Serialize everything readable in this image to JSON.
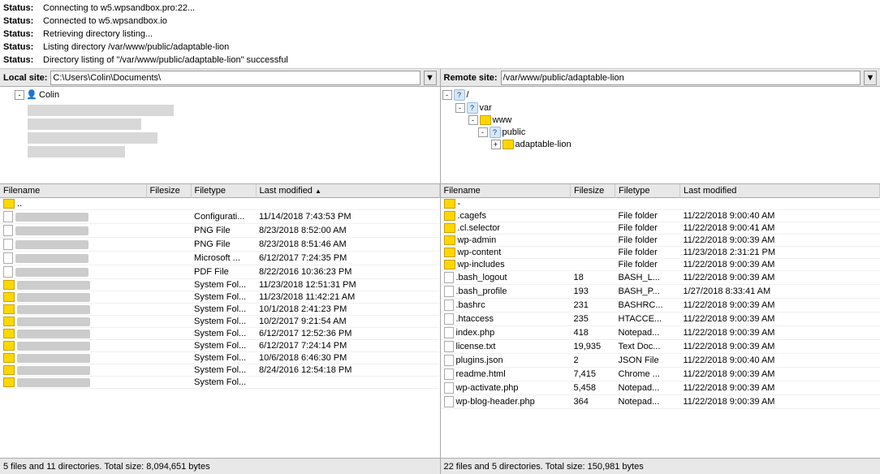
{
  "status_messages": [
    {
      "label": "Status:",
      "text": "Connecting to w5.wpsandbox.pro:22..."
    },
    {
      "label": "Status:",
      "text": "Connected to w5.wpsandbox.io"
    },
    {
      "label": "Status:",
      "text": "Retrieving directory listing..."
    },
    {
      "label": "Status:",
      "text": "Listing directory /var/www/public/adaptable-lion"
    },
    {
      "label": "Status:",
      "text": "Directory listing of \"/var/www/public/adaptable-lion\" successful"
    }
  ],
  "local": {
    "label": "Local site:",
    "path": "C:\\Users\\Colin\\Documents\\",
    "tree": [
      {
        "label": "Colin",
        "indent": 16,
        "type": "person",
        "expanded": true
      }
    ],
    "columns": [
      "Filename",
      "Filesize",
      "Filetype",
      "Last modified"
    ],
    "files": [
      {
        "name": "..",
        "size": "",
        "type": "",
        "modified": "",
        "icon": "folder"
      },
      {
        "name": "",
        "size": "",
        "type": "Configurati...",
        "modified": "11/14/2018 7:43:53 PM",
        "icon": "file",
        "blurred": true
      },
      {
        "name": "",
        "size": "",
        "type": "PNG File",
        "modified": "8/23/2018 8:52:00 AM",
        "icon": "file",
        "blurred": true
      },
      {
        "name": "",
        "size": "",
        "type": "PNG File",
        "modified": "8/23/2018 8:51:46 AM",
        "icon": "file",
        "blurred": true
      },
      {
        "name": "",
        "size": "",
        "type": "Microsoft ...",
        "modified": "6/12/2017 7:24:35 PM",
        "icon": "file",
        "blurred": true
      },
      {
        "name": "",
        "size": "",
        "type": "PDF File",
        "modified": "8/22/2016 10:36:23 PM",
        "icon": "file",
        "blurred": true
      },
      {
        "name": "",
        "size": "",
        "type": "System Fol...",
        "modified": "11/23/2018 12:51:31 PM",
        "icon": "folder",
        "blurred": true
      },
      {
        "name": "",
        "size": "",
        "type": "System Fol...",
        "modified": "11/23/2018 11:42:21 AM",
        "icon": "folder",
        "blurred": true
      },
      {
        "name": "",
        "size": "",
        "type": "System Fol...",
        "modified": "10/1/2018 2:41:23 PM",
        "icon": "folder",
        "blurred": true
      },
      {
        "name": "",
        "size": "",
        "type": "System Fol...",
        "modified": "10/2/2017 9:21:54 AM",
        "icon": "folder",
        "blurred": true
      },
      {
        "name": "",
        "size": "",
        "type": "System Fol...",
        "modified": "6/12/2017 12:52:36 PM",
        "icon": "folder",
        "blurred": true
      },
      {
        "name": "",
        "size": "",
        "type": "System Fol...",
        "modified": "6/12/2017 7:24:14 PM",
        "icon": "folder",
        "blurred": true
      },
      {
        "name": "",
        "size": "",
        "type": "System Fol...",
        "modified": "10/6/2018 6:46:30 PM",
        "icon": "folder",
        "blurred": true
      },
      {
        "name": "",
        "size": "",
        "type": "System Fol...",
        "modified": "8/24/2016 12:54:18 PM",
        "icon": "folder",
        "blurred": true
      },
      {
        "name": "",
        "size": "",
        "type": "System Fol...",
        "modified": "",
        "icon": "folder",
        "blurred": true
      }
    ],
    "footer": "5 files and 11 directories. Total size: 8,094,651 bytes"
  },
  "remote": {
    "label": "Remote site:",
    "path": "/var/www/public/adaptable-lion",
    "tree": [
      {
        "label": "/",
        "indent": 0,
        "type": "question",
        "expanded": true
      },
      {
        "label": "var",
        "indent": 16,
        "type": "question",
        "expanded": true
      },
      {
        "label": "www",
        "indent": 32,
        "type": "folder",
        "expanded": true
      },
      {
        "label": "public",
        "indent": 44,
        "type": "question",
        "expanded": true
      },
      {
        "label": "adaptable-lion",
        "indent": 60,
        "type": "folder",
        "expanded": false
      }
    ],
    "columns": [
      "Filename",
      "Filesize",
      "Filetype",
      "Last modified"
    ],
    "files": [
      {
        "name": "-",
        "size": "",
        "type": "",
        "modified": "",
        "icon": "folder"
      },
      {
        "name": ".cagefs",
        "size": "",
        "type": "File folder",
        "modified": "11/22/2018 9:00:40 AM",
        "icon": "folder"
      },
      {
        "name": ".cl.selector",
        "size": "",
        "type": "File folder",
        "modified": "11/22/2018 9:00:41 AM",
        "icon": "folder"
      },
      {
        "name": "wp-admin",
        "size": "",
        "type": "File folder",
        "modified": "11/22/2018 9:00:39 AM",
        "icon": "folder"
      },
      {
        "name": "wp-content",
        "size": "",
        "type": "File folder",
        "modified": "11/23/2018 2:31:21 PM",
        "icon": "folder"
      },
      {
        "name": "wp-includes",
        "size": "",
        "type": "File folder",
        "modified": "11/22/2018 9:00:39 AM",
        "icon": "folder"
      },
      {
        "name": ".bash_logout",
        "size": "18",
        "type": "BASH_L...",
        "modified": "11/22/2018 9:00:39 AM",
        "icon": "file"
      },
      {
        "name": ".bash_profile",
        "size": "193",
        "type": "BASH_P...",
        "modified": "1/27/2018 8:33:41 AM",
        "icon": "file"
      },
      {
        "name": ".bashrc",
        "size": "231",
        "type": "BASHRC...",
        "modified": "11/22/2018 9:00:39 AM",
        "icon": "file"
      },
      {
        "name": ".htaccess",
        "size": "235",
        "type": "HTACCE...",
        "modified": "11/22/2018 9:00:39 AM",
        "icon": "file"
      },
      {
        "name": "index.php",
        "size": "418",
        "type": "Notepad...",
        "modified": "11/22/2018 9:00:39 AM",
        "icon": "file"
      },
      {
        "name": "license.txt",
        "size": "19,935",
        "type": "Text Doc...",
        "modified": "11/22/2018 9:00:39 AM",
        "icon": "file"
      },
      {
        "name": "plugins.json",
        "size": "2",
        "type": "JSON File",
        "modified": "11/22/2018 9:00:40 AM",
        "icon": "file"
      },
      {
        "name": "readme.html",
        "size": "7,415",
        "type": "Chrome ...",
        "modified": "11/22/2018 9:00:39 AM",
        "icon": "file"
      },
      {
        "name": "wp-activate.php",
        "size": "5,458",
        "type": "Notepad...",
        "modified": "11/22/2018 9:00:39 AM",
        "icon": "file"
      },
      {
        "name": "wp-blog-header.php",
        "size": "364",
        "type": "Notepad...",
        "modified": "11/22/2018 9:00:39 AM",
        "icon": "file"
      }
    ],
    "footer": "22 files and 5 directories. Total size: 150,981 bytes"
  }
}
